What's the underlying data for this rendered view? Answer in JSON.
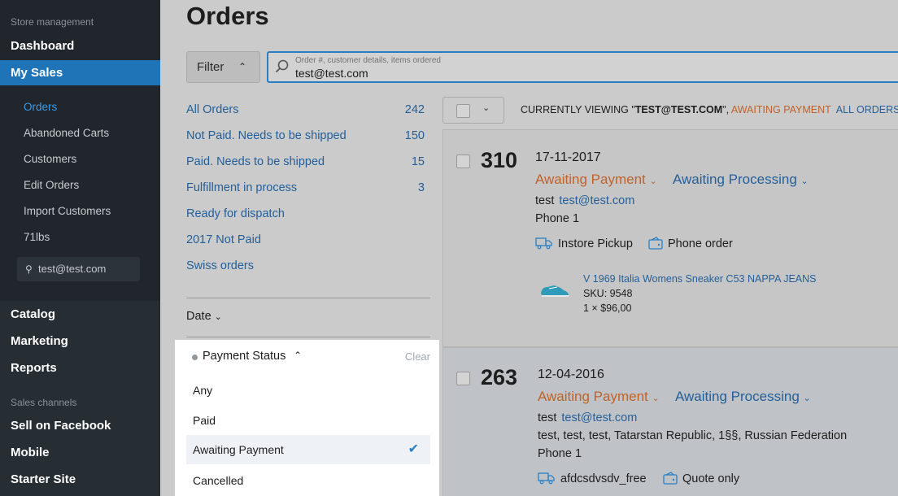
{
  "sidebar": {
    "section_store": "Store management",
    "dashboard": "Dashboard",
    "my_sales": "My Sales",
    "sub": [
      "Orders",
      "Abandoned Carts",
      "Customers",
      "Edit Orders",
      "Import Customers",
      "71lbs"
    ],
    "search_value": "test@test.com",
    "catalog": "Catalog",
    "marketing": "Marketing",
    "reports": "Reports",
    "section_channels": "Sales channels",
    "sell_on_facebook": "Sell on Facebook",
    "mobile": "Mobile",
    "starter_site": "Starter Site"
  },
  "header": {
    "title": "Orders"
  },
  "filter": {
    "label": "Filter"
  },
  "search": {
    "placeholder": "Order #, customer details, items ordered",
    "value": "test@test.com"
  },
  "saved_filters": [
    {
      "label": "All Orders",
      "count": "242"
    },
    {
      "label": "Not Paid. Needs to be shipped",
      "count": "150"
    },
    {
      "label": "Paid. Needs to be shipped",
      "count": "15"
    },
    {
      "label": "Fulfillment in process",
      "count": "3"
    },
    {
      "label": "Ready for dispatch",
      "count": ""
    },
    {
      "label": "2017 Not Paid",
      "count": ""
    },
    {
      "label": "Swiss orders",
      "count": ""
    }
  ],
  "date_filter": {
    "label": "Date"
  },
  "payment_status": {
    "title": "Payment Status",
    "clear": "Clear",
    "options": [
      "Any",
      "Paid",
      "Awaiting Payment",
      "Cancelled"
    ],
    "selected": "Awaiting Payment"
  },
  "toolbar": {
    "viewing_prefix": "CURRENTLY VIEWING \"",
    "viewing_query": "TEST@TEST.COM",
    "viewing_sep": "\", ",
    "viewing_status": "AWAITING PAYMENT",
    "all_orders": "ALL ORDERS"
  },
  "orders": [
    {
      "number": "310",
      "date": "17-11-2017",
      "payment_status": "Awaiting Payment",
      "fulfillment_status": "Awaiting Processing",
      "customer_name": "test",
      "customer_email": "test@test.com",
      "phone": "Phone 1",
      "shipping": "Instore Pickup",
      "payment": "Phone order",
      "product": {
        "name": "V 1969 Italia Womens Sneaker C53 NAPPA JEANS",
        "sku": "SKU: 9548",
        "qty_price": "1 × $96,00"
      }
    },
    {
      "number": "263",
      "date": "12-04-2016",
      "payment_status": "Awaiting Payment",
      "fulfillment_status": "Awaiting Processing",
      "customer_name": "test",
      "customer_email": "test@test.com",
      "address": "test, test, test, Tatarstan Republic, 1§§, Russian Federation",
      "phone": "Phone 1",
      "shipping": "afdcsdvsdv_free",
      "payment": "Quote only"
    }
  ],
  "colors": {
    "sidebar_bg": "#20262b",
    "active_blue": "#1f74b8",
    "link_blue": "#245f9a",
    "status_orange": "#c0622a"
  }
}
